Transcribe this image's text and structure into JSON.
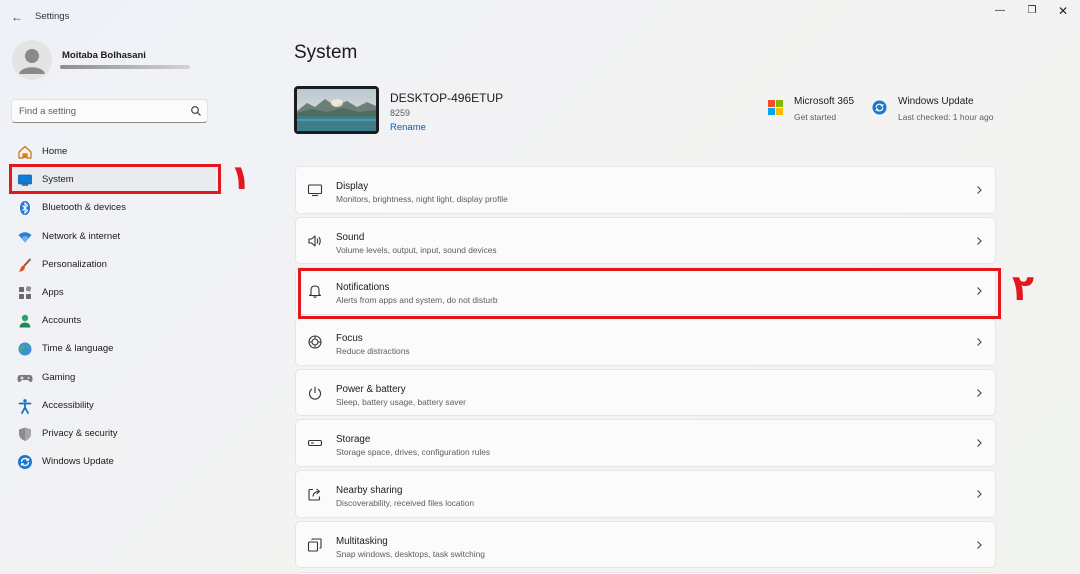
{
  "window": {
    "title": "Settings",
    "back_glyph": "←",
    "min_glyph": "—",
    "max_glyph": "❐",
    "close_glyph": "✕"
  },
  "user": {
    "name": "Moitaba Bolhasani"
  },
  "search": {
    "placeholder": "Find a setting",
    "icon": "search-icon"
  },
  "sidebar": {
    "items": [
      {
        "label": "Home",
        "icon": "home-icon"
      },
      {
        "label": "System",
        "icon": "system-icon",
        "active": true
      },
      {
        "label": "Bluetooth & devices",
        "icon": "bluetooth-icon"
      },
      {
        "label": "Network & internet",
        "icon": "wifi-icon"
      },
      {
        "label": "Personalization",
        "icon": "brush-icon"
      },
      {
        "label": "Apps",
        "icon": "apps-icon"
      },
      {
        "label": "Accounts",
        "icon": "accounts-icon"
      },
      {
        "label": "Time & language",
        "icon": "globe-icon"
      },
      {
        "label": "Gaming",
        "icon": "gamepad-icon"
      },
      {
        "label": "Accessibility",
        "icon": "accessibility-icon"
      },
      {
        "label": "Privacy & security",
        "icon": "shield-icon"
      },
      {
        "label": "Windows Update",
        "icon": "windows-update-icon"
      }
    ]
  },
  "annotations": {
    "marker_1": "١",
    "marker_2": "٢",
    "color": "#e4161e"
  },
  "main": {
    "title": "System",
    "device": {
      "name": "DESKTOP-496ETUP",
      "model": "8259",
      "rename_label": "Rename"
    },
    "quick_links": [
      {
        "title": "Microsoft 365",
        "subtitle": "Get started",
        "icon": "microsoft-logo-icon"
      },
      {
        "title": "Windows Update",
        "subtitle": "Last checked: 1 hour ago",
        "icon": "windows-update-icon"
      }
    ],
    "cards": [
      {
        "title": "Display",
        "subtitle": "Monitors, brightness, night light, display profile",
        "icon": "display-icon"
      },
      {
        "title": "Sound",
        "subtitle": "Volume levels, output, input, sound devices",
        "icon": "speaker-icon"
      },
      {
        "title": "Notifications",
        "subtitle": "Alerts from apps and system, do not disturb",
        "icon": "bell-icon"
      },
      {
        "title": "Focus",
        "subtitle": "Reduce distractions",
        "icon": "focus-icon"
      },
      {
        "title": "Power & battery",
        "subtitle": "Sleep, battery usage, battery saver",
        "icon": "power-icon"
      },
      {
        "title": "Storage",
        "subtitle": "Storage space, drives, configuration rules",
        "icon": "storage-icon"
      },
      {
        "title": "Nearby sharing",
        "subtitle": "Discoverability, received files location",
        "icon": "share-icon"
      },
      {
        "title": "Multitasking",
        "subtitle": "Snap windows, desktops, task switching",
        "icon": "multitasking-icon"
      }
    ]
  },
  "colors": {
    "accent": "#005fb8",
    "system_icon": "#0f7dd6"
  }
}
